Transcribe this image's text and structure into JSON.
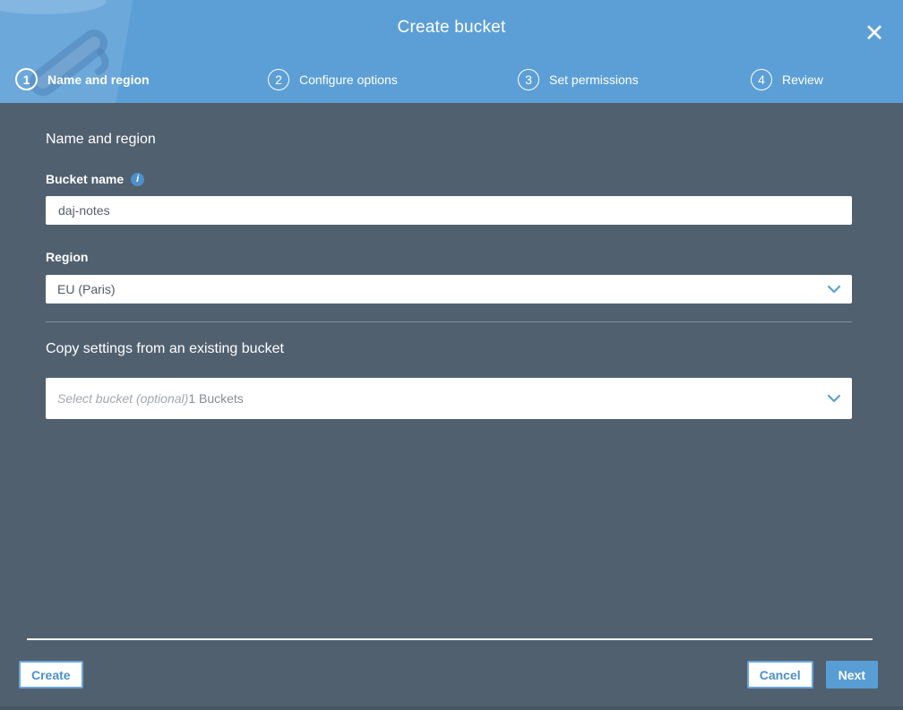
{
  "modal": {
    "title": "Create bucket",
    "close_icon": "✕"
  },
  "steps": [
    {
      "number": "1",
      "label": "Name and region",
      "active": true
    },
    {
      "number": "2",
      "label": "Configure options",
      "active": false
    },
    {
      "number": "3",
      "label": "Set permissions",
      "active": false
    },
    {
      "number": "4",
      "label": "Review",
      "active": false
    }
  ],
  "form": {
    "section_heading": "Name and region",
    "bucket_name": {
      "label": "Bucket name",
      "info_icon": "i",
      "value": "daj-notes"
    },
    "region": {
      "label": "Region",
      "value": "EU (Paris)"
    },
    "copy_settings_heading": "Copy settings from an existing bucket",
    "bucket_select": {
      "placeholder": "Select bucket (optional)",
      "suffix": "1 Buckets"
    }
  },
  "footer": {
    "create_label": "Create",
    "cancel_label": "Cancel",
    "next_label": "Next"
  },
  "colors": {
    "header_blue": "#5C9FD6",
    "body_slate": "#51606F",
    "accent_blue": "#4C90CA"
  }
}
